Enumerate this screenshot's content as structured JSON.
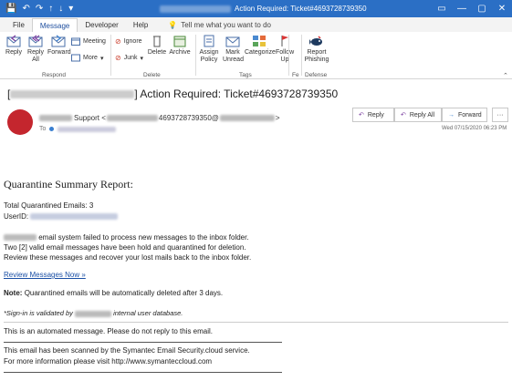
{
  "titlebar": {
    "qat": [
      "💾",
      "↶",
      "↷",
      "↑",
      "↓",
      "▾"
    ],
    "title": "Action Required: Ticket#4693728739350",
    "controls": [
      "▭",
      "—",
      "▢",
      "✕"
    ]
  },
  "tabs": [
    {
      "label": "File"
    },
    {
      "label": "Message"
    },
    {
      "label": "Developer"
    },
    {
      "label": "Help"
    }
  ],
  "tell_me": "Tell me what you want to do",
  "ribbon": {
    "delete": "Delete",
    "reply": "Reply",
    "reply_all": "Reply All",
    "forward": "Forward",
    "meeting": "Meeting",
    "more": "More",
    "group_respond": "Respond",
    "ignore": "Ignore",
    "junk": "Junk",
    "archive": "Archive",
    "group_delete": "Delete",
    "assign_policy": "Assign Policy",
    "mark_unread": "Mark Unread",
    "categorize": "Categorize",
    "follow_up": "Follow Up",
    "group_tags": "Tags",
    "group_fe": "Fe",
    "report_phishing": "Report Phishing",
    "group_defense": "Defense"
  },
  "message": {
    "subject_prefix": "[",
    "subject_suffix": "] Action Required: Ticket#4693728739350",
    "sender_name": "Support <",
    "sender_addr": "4693728739350@",
    "sender_end": ">",
    "to_label": "To",
    "date": "Wed 07/15/2020 06:23 PM",
    "reply_btn": "Reply",
    "reply_all_btn": "Reply All",
    "forward_btn": "Forward",
    "more_btn": "···"
  },
  "body": {
    "heading": "Quarantine Summary Report:",
    "total": "Total Quarantined Emails: 3",
    "userid_label": "UserID:",
    "p1_line1": "email system failed to process new messages to the inbox folder.",
    "p1_line2": "Two [2] valid email messages have been hold and quarantined for deletion.",
    "p1_line3": "Review these messages and recover your lost mails back to the inbox folder.",
    "review_link": "Review Messages Now »",
    "note_label": "Note:",
    "note_text": "Quarantined emails will be automatically deleted after 3 days.",
    "signin_pre": "*Sign-in is validated by",
    "signin_post": "internal user database.",
    "automated": "This is an automated message. Please do not reply to this email.",
    "scanned1": "This email has been scanned by the Symantec Email Security.cloud service.",
    "scanned2": "For more information please visit http://www.symanteccloud.com"
  }
}
